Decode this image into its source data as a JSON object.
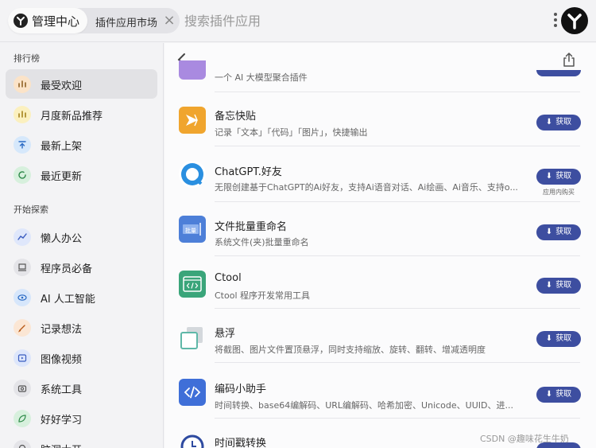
{
  "header": {
    "main_label": "管理中心",
    "tab_label": "插件应用市场",
    "search_placeholder": "搜索插件应用"
  },
  "sidebar": {
    "section1_title": "排行榜",
    "section2_title": "开始探索",
    "items": [
      {
        "label": "最受欢迎",
        "icon": "bar-chart-icon",
        "active": true
      },
      {
        "label": "月度新品推荐",
        "icon": "bar-chart-icon",
        "active": false
      },
      {
        "label": "最新上架",
        "icon": "upload-icon",
        "active": false
      },
      {
        "label": "最近更新",
        "icon": "refresh-icon",
        "active": false
      },
      {
        "label": "懒人办公",
        "icon": "chart-line-icon",
        "active": false
      },
      {
        "label": "程序员必备",
        "icon": "laptop-icon",
        "active": false
      },
      {
        "label": "AI 人工智能",
        "icon": "eye-icon",
        "active": false
      },
      {
        "label": "记录想法",
        "icon": "pencil-icon",
        "active": false
      },
      {
        "label": "图像视频",
        "icon": "play-icon",
        "active": false
      },
      {
        "label": "系统工具",
        "icon": "camera-icon",
        "active": false
      },
      {
        "label": "好好学习",
        "icon": "leaf-icon",
        "active": false
      },
      {
        "label": "脑洞大开",
        "icon": "bulb-icon",
        "active": false
      }
    ]
  },
  "main": {
    "get_label": "获取",
    "in_app_purchase": "应用内购买",
    "partial_top_desc": "一个 AI 大模型聚合插件",
    "items": [
      {
        "title": "备忘快贴",
        "desc": "记录「文本」「代码」「图片」，快捷输出",
        "icon": "star-burst-icon",
        "color": "#f0a52e"
      },
      {
        "title": "ChatGPT.好友",
        "desc": "无限创建基于ChatGPT的Ai好友，支持Ai语音对话、Ai绘画、Ai音乐、支持o...",
        "icon": "chat-bubble-icon",
        "color": "#2a7fd6",
        "iap": true
      },
      {
        "title": "文件批量重命名",
        "desc": "系统文件(夹)批量重命名",
        "icon": "rename-icon",
        "color": "#4d7fd8"
      },
      {
        "title": "Ctool",
        "desc": "Ctool 程序开发常用工具",
        "icon": "code-window-icon",
        "color": "#3aa57a"
      },
      {
        "title": "悬浮",
        "desc": "将截图、图片文件置顶悬浮，同时支持缩放、旋转、翻转、增减透明度",
        "icon": "float-window-icon",
        "color": "#5fb8a8"
      },
      {
        "title": "编码小助手",
        "desc": "时间转换、base64编解码、URL编解码、哈希加密、Unicode、UUID、进...",
        "icon": "code-icon",
        "color": "#3f6fd8"
      },
      {
        "title": "时间戳转换",
        "desc": "",
        "icon": "clock-icon",
        "color": "#2e4aa0"
      }
    ]
  },
  "watermark": "CSDN @趣味花生牛奶"
}
